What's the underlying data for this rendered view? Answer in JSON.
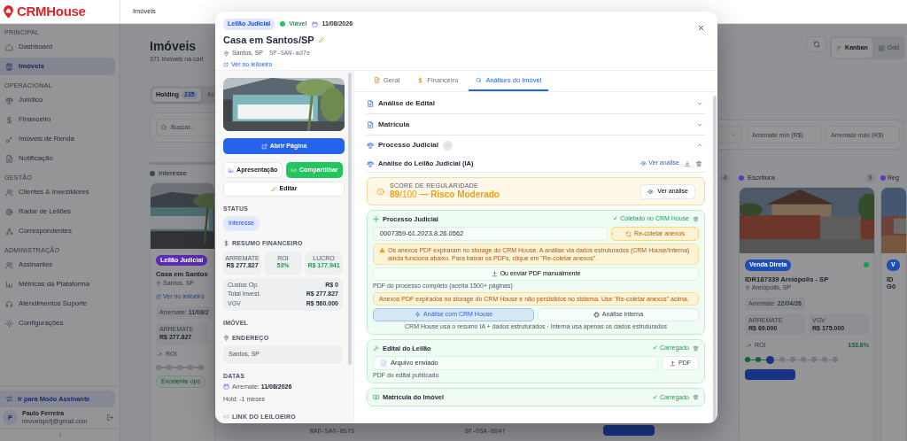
{
  "header": {
    "breadcrumb": "Imóveis"
  },
  "sidebar": {
    "logo": "CRMHouse",
    "sections": [
      {
        "title": "PRINCIPAL",
        "items": [
          {
            "label": "Dashboard",
            "selected": false
          },
          {
            "label": "Imóveis",
            "selected": true
          }
        ]
      },
      {
        "title": "OPERACIONAL",
        "items": [
          {
            "label": "Jurídico",
            "selected": false
          },
          {
            "label": "Financeiro",
            "selected": false
          },
          {
            "label": "Imóveis de Renda",
            "selected": false
          },
          {
            "label": "Notificação",
            "selected": false
          }
        ]
      },
      {
        "title": "GESTÃO",
        "items": [
          {
            "label": "Clientes & Investidores",
            "selected": false
          },
          {
            "label": "Radar de Leilões",
            "selected": false
          },
          {
            "label": "Correspondentes",
            "selected": false
          }
        ]
      },
      {
        "title": "ADMINISTRAÇÃO",
        "items": [
          {
            "label": "Assinantes",
            "selected": false
          },
          {
            "label": "Métricas da Plataforma",
            "selected": false
          },
          {
            "label": "Atendimentos Suporte",
            "selected": false
          },
          {
            "label": "Configurações",
            "selected": false
          }
        ]
      }
    ],
    "mode_button": "Ir para Modo Assinante",
    "user": {
      "initial": "P",
      "name": "Paulo Ferreira",
      "email": "imoveispcfj@gmail.com"
    }
  },
  "page": {
    "title": "Imóveis",
    "subtitle": "371 imóveis na cart",
    "tabs": [
      {
        "label": "Holding",
        "count": "235",
        "selected": true
      },
      {
        "label": "As",
        "selected": false
      }
    ],
    "search": {
      "placeholder": "Buscar..."
    },
    "view_toggle": [
      {
        "label": "Kanban",
        "selected": true
      },
      {
        "label": "Grid",
        "selected": false
      }
    ],
    "price_filters": [
      {
        "placeholder": "Arremate mín (R$)"
      },
      {
        "placeholder": "Arremate máx (R$)"
      }
    ]
  },
  "board": {
    "left_column": {
      "title": "Interesse",
      "color": "#3f4654",
      "card": {
        "badge": {
          "label": "Leilão Judicial",
          "color": "#5b2bb5"
        },
        "title": "Casa em Santos",
        "location": "Santos, SP",
        "link": "Ver no leiloeiro",
        "date": "Arremate: **11/08/2**",
        "stats": [
          {
            "label": "ARREMATE",
            "value": "R$ 277.827"
          }
        ],
        "roi_label": "ROI",
        "steps": [
          {
            "done": false,
            "current": false
          },
          {
            "done": false,
            "current": false
          },
          {
            "done": false,
            "current": false
          },
          {
            "done": false,
            "current": false
          },
          {
            "done": false,
            "current": false
          }
        ],
        "opportunity": "Excelente opo"
      }
    },
    "hidden_column_count": "4",
    "hidden_codes": [
      "RAD-SAO-8575",
      "SP-OSA-8847"
    ],
    "right_columns": [
      {
        "title": "Escritura",
        "color": "#6236c9",
        "count": "9",
        "card": {
          "badge": {
            "label": "Venda Direta",
            "color": "#1e4fb8"
          },
          "status_dot": {
            "color": "#1c9a4a"
          },
          "title": "IDR187339 Areiópolis - SP",
          "location": "Areiópolis, SP",
          "date": "Arremate: **22/04/26**",
          "stats": [
            {
              "label": "ARREMATE",
              "value": "R$ 69.000"
            },
            {
              "label": "VGV",
              "value": "R$ 175.000"
            }
          ],
          "roi_label": "ROI",
          "roi": "153.6%",
          "steps": [
            {
              "done": true,
              "current": false
            },
            {
              "done": true,
              "current": false
            },
            {
              "done": false,
              "current": true
            },
            {
              "done": false,
              "current": false
            },
            {
              "done": false,
              "current": false
            },
            {
              "done": false,
              "current": false
            },
            {
              "done": false,
              "current": false
            },
            {
              "done": false,
              "current": false
            },
            {
              "done": false,
              "current": false
            }
          ]
        }
      },
      {
        "title": "Reg",
        "color": "#6236c9",
        "card": {
          "badge": {
            "label": "V",
            "color": "#1e4fb8"
          },
          "title": "ID",
          "subtitle": "G0"
        }
      }
    ]
  },
  "modal": {
    "badges": [
      {
        "kind": "type",
        "label": "Leilão Judicial"
      },
      {
        "kind": "status",
        "label": "Viável",
        "color": "#22c55e"
      },
      {
        "kind": "date",
        "label": "11/08/2026"
      }
    ],
    "title": "Casa em Santos/SP",
    "location": "Santos, SP",
    "code": "SP-SAN-ad7e",
    "link": "Ver no leiloeiro",
    "side": {
      "actions": [
        {
          "kind": "primary",
          "label": "Abrir Página"
        },
        {
          "kind": "outline",
          "label": "Apresentação"
        },
        {
          "kind": "success",
          "label": "Compartilhar"
        },
        {
          "kind": "outline",
          "label": "Editar"
        }
      ],
      "status_heading": "STATUS",
      "status": "Interesse",
      "finance_heading": "RESUMO FINANCEIRO",
      "stats": [
        {
          "label": "ARREMATE",
          "value": "R$ 277.827",
          "positive": false
        },
        {
          "label": "ROI",
          "value": "53%",
          "positive": true
        },
        {
          "label": "LUCRO",
          "value": "R$ 177.941",
          "positive": true
        }
      ],
      "breakdown": [
        {
          "label": "Custos Op.",
          "value": "R$ 0"
        },
        {
          "label": "Total Invest.",
          "value": "R$ 277.827"
        },
        {
          "label": "VGV",
          "value": "R$ 560.000"
        }
      ],
      "property_heading": "IMÓVEL",
      "address_heading": "ENDEREÇO",
      "address": "Santos, SP",
      "dates_heading": "DATAS",
      "arremate": "Arremate: **11/08/2026**",
      "hold": "Hold: -1 meses",
      "link_heading": "LINK DO LEILOEIRO"
    },
    "tabs": [
      {
        "label": "Geral",
        "selected": false
      },
      {
        "label": "Financeiro",
        "selected": false
      },
      {
        "label": "Análises do Imóvel",
        "selected": true
      }
    ],
    "sections": [
      {
        "title": "Análise de Edital",
        "expanded": false,
        "verified": false
      },
      {
        "title": "Matrícula",
        "expanded": false,
        "verified": false
      },
      {
        "title": "Processo Judicial",
        "expanded": true,
        "verified": true
      }
    ],
    "analysis": {
      "title": "Análise do Leilão Judicial (IA)",
      "view_link": "Ver análise",
      "score_label": "SCORE DE REGULARIDADE",
      "score": "**89**/100 **— Risco Moderado**",
      "score_button": "Ver análise"
    },
    "documents": [
      {
        "kind": "process",
        "title": "Processo Judicial",
        "status": "✓ Coletado no CRM House",
        "value": "0007359-61.2023.8.26.0562",
        "action": "Re-coletar anexos",
        "warning": "Os anexos PDF expiraram no storage do CRM House. A análise via dados estruturados (CRM House/Interna) ainda funciona abaixo. Para baixar os PDFs, clique em \"Re-coletar anexos\".",
        "upload": "Ou enviar PDF manualmente",
        "hint": "PDF do processo completo (aceita 1500+ páginas)",
        "notice": "Anexos PDF expirados no storage do CRM House e não persistidos no sistema. Use \"Re-coletar anexos\" acima.",
        "modes": [
          {
            "label": "Análise com CRM House",
            "selected": true
          },
          {
            "label": "Análise interna",
            "selected": false
          }
        ],
        "modes_caption": "CRM House usa o resumo IA + dados estruturados · Interna usa apenas os dados estruturados"
      },
      {
        "kind": "edital",
        "title": "Edital do Leilão",
        "status": "✓ Carregado",
        "value": "Arquivo enviado",
        "action": "PDF",
        "hint": "PDF do edital publicado"
      },
      {
        "kind": "registry",
        "title": "Matrícula do Imóvel",
        "status": "✓ Carregado"
      }
    ]
  }
}
